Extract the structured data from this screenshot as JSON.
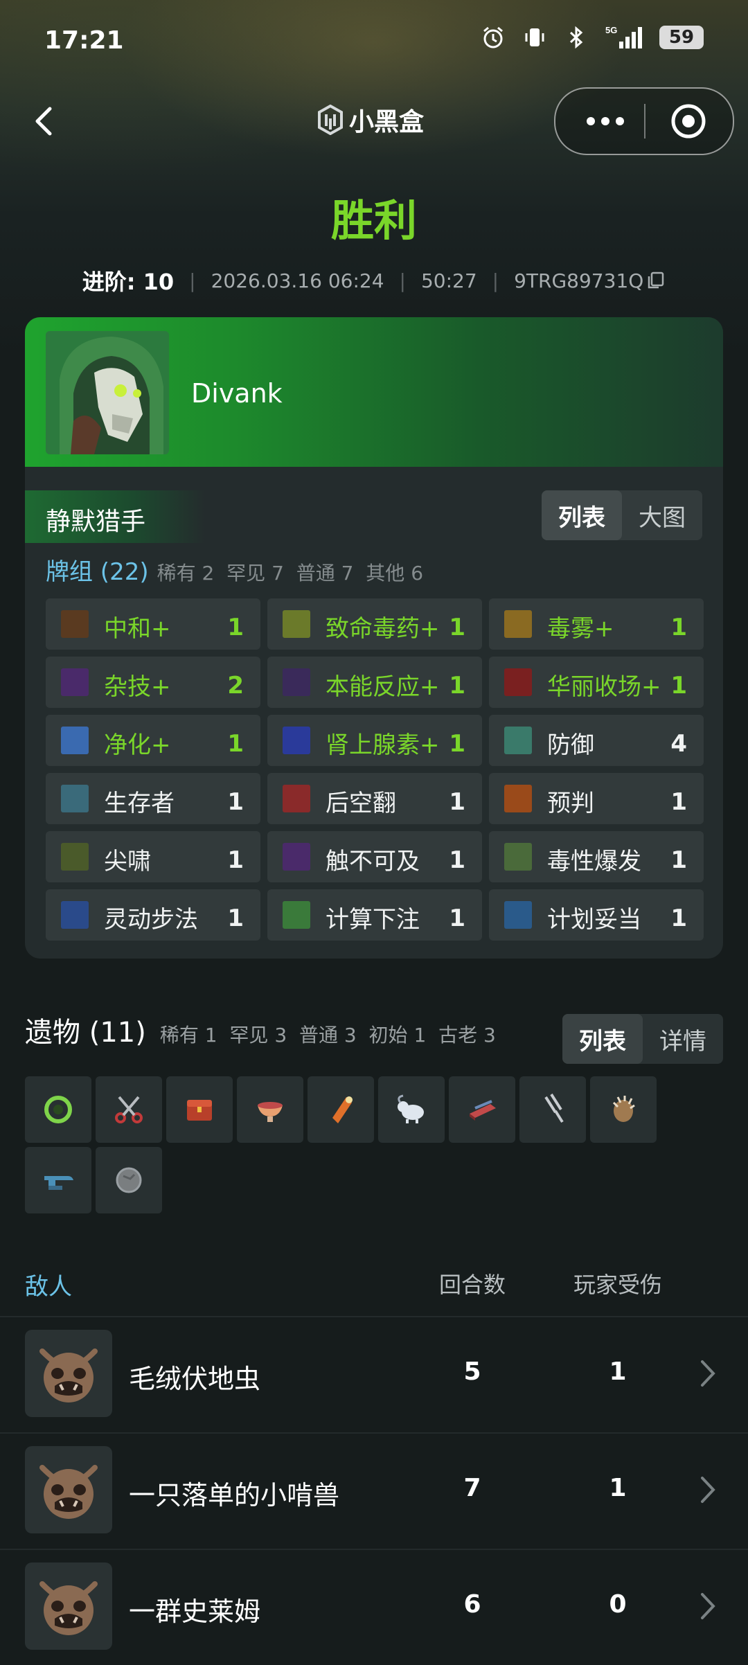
{
  "status_bar": {
    "time": "17:21",
    "network": "5G",
    "battery": "59",
    "icons": [
      "alarm-icon",
      "vibrate-icon",
      "bluetooth-icon",
      "signal-icon",
      "battery-icon"
    ]
  },
  "nav": {
    "brand": "小黑盒",
    "icons": [
      "back-arrow-icon",
      "more-dots-icon",
      "record-target-icon"
    ]
  },
  "result": {
    "title": "胜利",
    "ascension": "进阶: 10",
    "datetime": "2026.03.16 06:24",
    "duration": "50:27",
    "run_id": "9TRG89731Q"
  },
  "hero": {
    "name": "Divank",
    "character": "静默猎手",
    "view_tabs": [
      "列表",
      "大图"
    ],
    "active_tab": "列表"
  },
  "deck": {
    "title": "牌组 (22)",
    "stats": [
      {
        "label": "稀有",
        "value": "2"
      },
      {
        "label": "罕见",
        "value": "7"
      },
      {
        "label": "普通",
        "value": "7"
      },
      {
        "label": "其他",
        "value": "6"
      }
    ],
    "cards": [
      {
        "name": "中和+",
        "count": "1",
        "upgraded": true,
        "icon_color": "#5a3a20"
      },
      {
        "name": "致命毒药+",
        "count": "1",
        "upgraded": true,
        "icon_color": "#6b7a2a"
      },
      {
        "name": "毒雾+",
        "count": "1",
        "upgraded": true,
        "icon_color": "#8a6a22"
      },
      {
        "name": "杂技+",
        "count": "2",
        "upgraded": true,
        "icon_color": "#4a2a6a"
      },
      {
        "name": "本能反应+",
        "count": "1",
        "upgraded": true,
        "icon_color": "#3a2a5a"
      },
      {
        "name": "华丽收场+",
        "count": "1",
        "upgraded": true,
        "icon_color": "#7a2020"
      },
      {
        "name": "净化+",
        "count": "1",
        "upgraded": true,
        "icon_color": "#3a6ab0"
      },
      {
        "name": "肾上腺素+",
        "count": "1",
        "upgraded": true,
        "icon_color": "#2a3a9a"
      },
      {
        "name": "防御",
        "count": "4",
        "upgraded": false,
        "icon_color": "#3a7a6a"
      },
      {
        "name": "生存者",
        "count": "1",
        "upgraded": false,
        "icon_color": "#3a6a7a"
      },
      {
        "name": "后空翻",
        "count": "1",
        "upgraded": false,
        "icon_color": "#8a2a2a"
      },
      {
        "name": "预判",
        "count": "1",
        "upgraded": false,
        "icon_color": "#9a4a1a"
      },
      {
        "name": "尖啸",
        "count": "1",
        "upgraded": false,
        "icon_color": "#4a5a2a"
      },
      {
        "name": "触不可及",
        "count": "1",
        "upgraded": false,
        "icon_color": "#4a2a6a"
      },
      {
        "name": "毒性爆发",
        "count": "1",
        "upgraded": false,
        "icon_color": "#4a6a3a"
      },
      {
        "name": "灵动步法",
        "count": "1",
        "upgraded": false,
        "icon_color": "#2a4a8a"
      },
      {
        "name": "计算下注",
        "count": "1",
        "upgraded": false,
        "icon_color": "#3a7a3a"
      },
      {
        "name": "计划妥当",
        "count": "1",
        "upgraded": false,
        "icon_color": "#2a5a8a"
      }
    ]
  },
  "relics": {
    "title": "遗物 (11)",
    "stats": [
      {
        "label": "稀有",
        "value": "1"
      },
      {
        "label": "罕见",
        "value": "3"
      },
      {
        "label": "普通",
        "value": "3"
      },
      {
        "label": "初始",
        "value": "1"
      },
      {
        "label": "古老",
        "value": "3"
      }
    ],
    "view_tabs": [
      "列表",
      "详情"
    ],
    "active_tab": "列表",
    "items": [
      {
        "icon": "ring-relic-icon",
        "color": "#7fd44a"
      },
      {
        "icon": "scissors-relic-icon",
        "color": "#c23a3a"
      },
      {
        "icon": "chest-relic-icon",
        "color": "#b8402a"
      },
      {
        "icon": "bowl-relic-icon",
        "color": "#e8a070"
      },
      {
        "icon": "lantern-relic-icon",
        "color": "#e0702a"
      },
      {
        "icon": "ram-relic-icon",
        "color": "#dfe6ee"
      },
      {
        "icon": "whetstone-relic-icon",
        "color": "#c24a4a"
      },
      {
        "icon": "tuning-fork-relic-icon",
        "color": "#c8ccd0"
      },
      {
        "icon": "spiked-shell-relic-icon",
        "color": "#a07a50"
      },
      {
        "icon": "anvil-relic-icon",
        "color": "#4a90b8"
      },
      {
        "icon": "stone-relic-icon",
        "color": "#7a7e80"
      }
    ]
  },
  "enemies": {
    "header": {
      "name": "敌人",
      "turns": "回合数",
      "damage": "玩家受伤"
    },
    "rows": [
      {
        "name": "毛绒伏地虫",
        "turns": "5",
        "damage": "1"
      },
      {
        "name": "一只落单的小啃兽",
        "turns": "7",
        "damage": "1"
      },
      {
        "name": "一群史莱姆",
        "turns": "6",
        "damage": "0"
      }
    ]
  }
}
